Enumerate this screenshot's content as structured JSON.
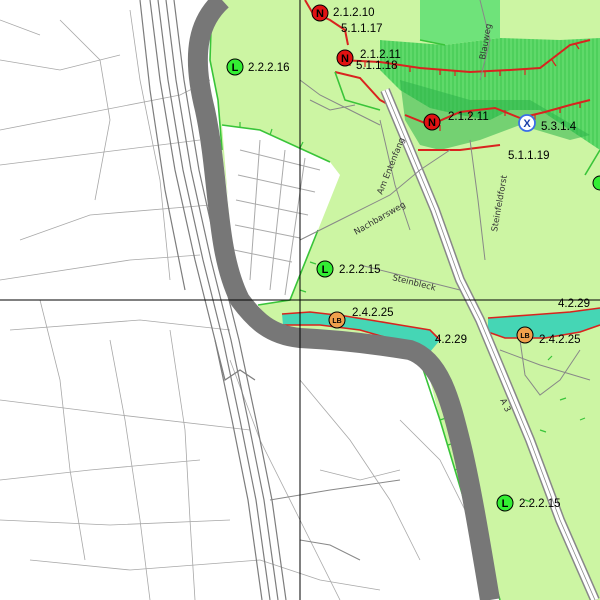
{
  "colors": {
    "background": "#ffffff",
    "light_green": "#ccf5a3",
    "medium_green": "#6fe37a",
    "dark_green": "#2bb34a",
    "teal": "#45d6b5",
    "red_boundary": "#d9231f",
    "green_hatch": "#39c439",
    "grey_band": "#777777",
    "topo_line": "#999999",
    "marker_L": "#33ee33",
    "marker_N": "#e01212",
    "marker_LB": "#f0a04c",
    "marker_X": "#3a6ee8",
    "grid_line": "#000000"
  },
  "markers": [
    {
      "type": "N",
      "label": "2.1.2.10",
      "icon": "N-marker-icon"
    },
    {
      "type": "N",
      "label": "2.1.2.11",
      "icon": "N-marker-icon"
    },
    {
      "type": "N",
      "label": "2.1.2.11",
      "icon": "N-marker-icon"
    },
    {
      "type": "L",
      "label": "2.2.2.16",
      "icon": "L-marker-icon"
    },
    {
      "type": "L",
      "label": "2.2.2.15",
      "icon": "L-marker-icon"
    },
    {
      "type": "L",
      "label": "2.2.2.15",
      "icon": "L-marker-icon"
    },
    {
      "type": "LB",
      "label": "2.4.2.25",
      "icon": "LB-marker-icon"
    },
    {
      "type": "LB",
      "label": "2.4.2.25",
      "icon": "LB-marker-icon"
    },
    {
      "type": "X",
      "label": "5.3.1.4",
      "icon": "X-marker-icon"
    }
  ],
  "labels": {
    "l1": "5.1.1.17",
    "l2": "5.1.1.18",
    "l3": "5.1.1.19",
    "l4": "4.2.29",
    "l5": "4.2.29"
  },
  "streets": {
    "s1": "Am Entenfang",
    "s2": "Nachbarsweg",
    "s3": "Steinfeldforst",
    "s4": "Steinbleck",
    "s5": "Blauweg",
    "s6": "A 3"
  }
}
